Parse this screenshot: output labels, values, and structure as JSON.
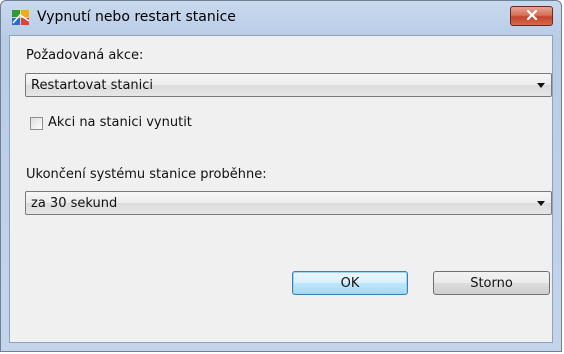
{
  "window": {
    "title": "Vypnutí nebo restart stanice",
    "icon": "avg-logo-icon",
    "close_icon": "close-x-icon"
  },
  "action": {
    "label": "Požadovaná akce:",
    "selected": "Restartovat stanici"
  },
  "force": {
    "label": "Akci na stanici vynutit",
    "checked": false
  },
  "shutdown": {
    "label": "Ukončení systému stanice proběhne:",
    "selected": "za 30 sekund"
  },
  "buttons": {
    "ok": "OK",
    "cancel": "Storno"
  },
  "colors": {
    "title_bar": "#c9d9ee",
    "client_bg": "#f0f0f0",
    "close_button": "#c4442a"
  }
}
